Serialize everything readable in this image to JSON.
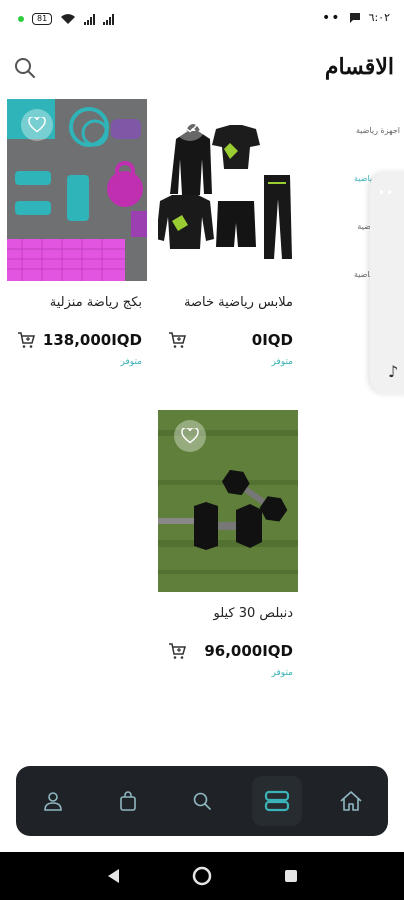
{
  "status_bar": {
    "battery": "81",
    "time": "٦:٠٢"
  },
  "header": {
    "title": "الاقسام"
  },
  "categories": [
    {
      "label": "اجهزة رياضية",
      "active": false
    },
    {
      "label": "ملابس رياضية",
      "active": true
    },
    {
      "label": "اوزان رياضية",
      "active": false
    },
    {
      "label": "ملابس رياضية",
      "active": false
    }
  ],
  "products": [
    {
      "name": "ملابس رياضية خاصة",
      "price": "0IQD",
      "stock": "متوفر",
      "image": "sportswear"
    },
    {
      "name": "بكج رياضة منزلية",
      "price": "138,000IQD",
      "stock": "متوفر",
      "image": "home-fitness-kit"
    },
    {
      "name": "دنبلص 30 كيلو",
      "price": "96,000IQD",
      "stock": "متوفر",
      "image": "dumbbells"
    }
  ],
  "bottom_nav": {
    "items": [
      "profile-icon",
      "shopping-bag-icon",
      "search-icon",
      "categories-icon",
      "home-icon"
    ],
    "active": "categories-icon",
    "accent": "#3bb3b8"
  },
  "colors": {
    "accent": "#3bb3b8",
    "nav_bg": "#1f2327"
  }
}
